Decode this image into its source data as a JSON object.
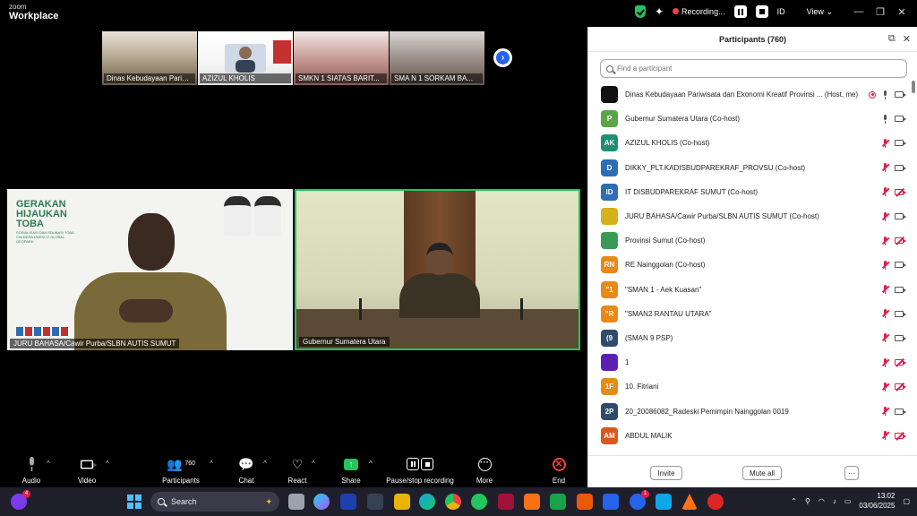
{
  "window": {
    "brand_line1": "zoom",
    "brand_line2": "Workplace",
    "recording_label": "Recording...",
    "id_label": "ID",
    "view_label": "View",
    "view_caret": "⌄",
    "minimize": "—",
    "restore": "❐",
    "close": "✕"
  },
  "gallery": {
    "thumbnails": [
      {
        "name": "Dinas Kebudayaan Pariwis..."
      },
      {
        "name": "AZIZUL KHOLIS"
      },
      {
        "name": "SMKN 1 SIATAS BARIT..."
      },
      {
        "name": "SMA N 1 SORKAM BA..."
      }
    ],
    "next_symbol": "›"
  },
  "tiles": {
    "left": {
      "name": "JURU BAHASA/Cawir Purba/SLBN AUTIS SUMUT",
      "banner_title": "GERAKAN HIJAUKAN TOBA",
      "banner_sub": "SOSIALISASI DAN EDUKASI TOBA CALDERA UNESCO GLOBAL GEOPARK"
    },
    "right": {
      "name": "Gubernur Sumatera Utara"
    }
  },
  "toolbar": {
    "audio": "Audio",
    "video": "Video",
    "participants": "Participants",
    "participants_count": "760",
    "chat": "Chat",
    "react": "React",
    "share": "Share",
    "recording": "Pause/stop recording",
    "more": "More",
    "end": "End",
    "caret": "^"
  },
  "panel": {
    "title": "Participants (760)",
    "search_placeholder": "Find a participant",
    "popout_icon": "⧉",
    "close_icon": "✕",
    "participants": [
      {
        "initials": "",
        "color": "#111111",
        "name": "Dinas Kebudayaan Pariwisata dan Ekonomi Kreatif Provinsi ... (Host, me)",
        "rec": true,
        "mic": "on",
        "cam": "on"
      },
      {
        "initials": "P",
        "color": "#5aa646",
        "name": "Gubernur Sumatera Utara (Co-host)",
        "rec": false,
        "mic": "on",
        "cam": "on"
      },
      {
        "initials": "AK",
        "color": "#1f8f74",
        "name": "AZIZUL KHOLIS (Co-host)",
        "rec": false,
        "mic": "off",
        "cam": "on"
      },
      {
        "initials": "D",
        "color": "#2f6db5",
        "name": "DIKKY_PLT.KADISBUDPAREKRAF_PROVSU (Co-host)",
        "rec": false,
        "mic": "off",
        "cam": "on"
      },
      {
        "initials": "ID",
        "color": "#2f6db5",
        "name": "IT DISBUDPAREKRAF SUMUT (Co-host)",
        "rec": false,
        "mic": "off",
        "cam": "off"
      },
      {
        "initials": "",
        "color": "#d6b21a",
        "name": "JURU BAHASA/Cawir Purba/SLBN AUTIS SUMUT (Co-host)",
        "rec": false,
        "mic": "off",
        "cam": "on"
      },
      {
        "initials": "",
        "color": "#3a9a55",
        "name": "Provinsi Sumut (Co-host)",
        "rec": false,
        "mic": "off",
        "cam": "off"
      },
      {
        "initials": "RN",
        "color": "#e8891a",
        "name": "RE Nainggolan (Co-host)",
        "rec": false,
        "mic": "off",
        "cam": "on"
      },
      {
        "initials": "\"1",
        "color": "#e8891a",
        "name": "\"SMAN 1 - Aek Kuasan\"",
        "rec": false,
        "mic": "off",
        "cam": "on"
      },
      {
        "initials": "\"R",
        "color": "#e8891a",
        "name": "\"SMAN2 RANTAU UTARA\"",
        "rec": false,
        "mic": "off",
        "cam": "on"
      },
      {
        "initials": "(9",
        "color": "#2f4a6b",
        "name": "(SMAN 9 PSP)",
        "rec": false,
        "mic": "off",
        "cam": "on"
      },
      {
        "initials": "",
        "color": "#5b21b6",
        "name": "1",
        "rec": false,
        "mic": "off",
        "cam": "off"
      },
      {
        "initials": "1F",
        "color": "#e8891a",
        "name": "10. Fitriani",
        "rec": false,
        "mic": "off",
        "cam": "off"
      },
      {
        "initials": "2P",
        "color": "#2f4a6b",
        "name": "20_20086082_Radeski Pemimpin Nainggolan 0019",
        "rec": false,
        "mic": "off",
        "cam": "on"
      },
      {
        "initials": "AM",
        "color": "#d9591c",
        "name": "ABDUL MALIK",
        "rec": false,
        "mic": "off",
        "cam": "off"
      }
    ],
    "invite": "Invite",
    "mute_all": "Mute all",
    "more": "···"
  },
  "taskbar": {
    "search_label": "Search",
    "notif_count": "4",
    "app_badge": "1",
    "time": "13:02",
    "date": "03/06/2025",
    "tray_caret": "⌃"
  }
}
